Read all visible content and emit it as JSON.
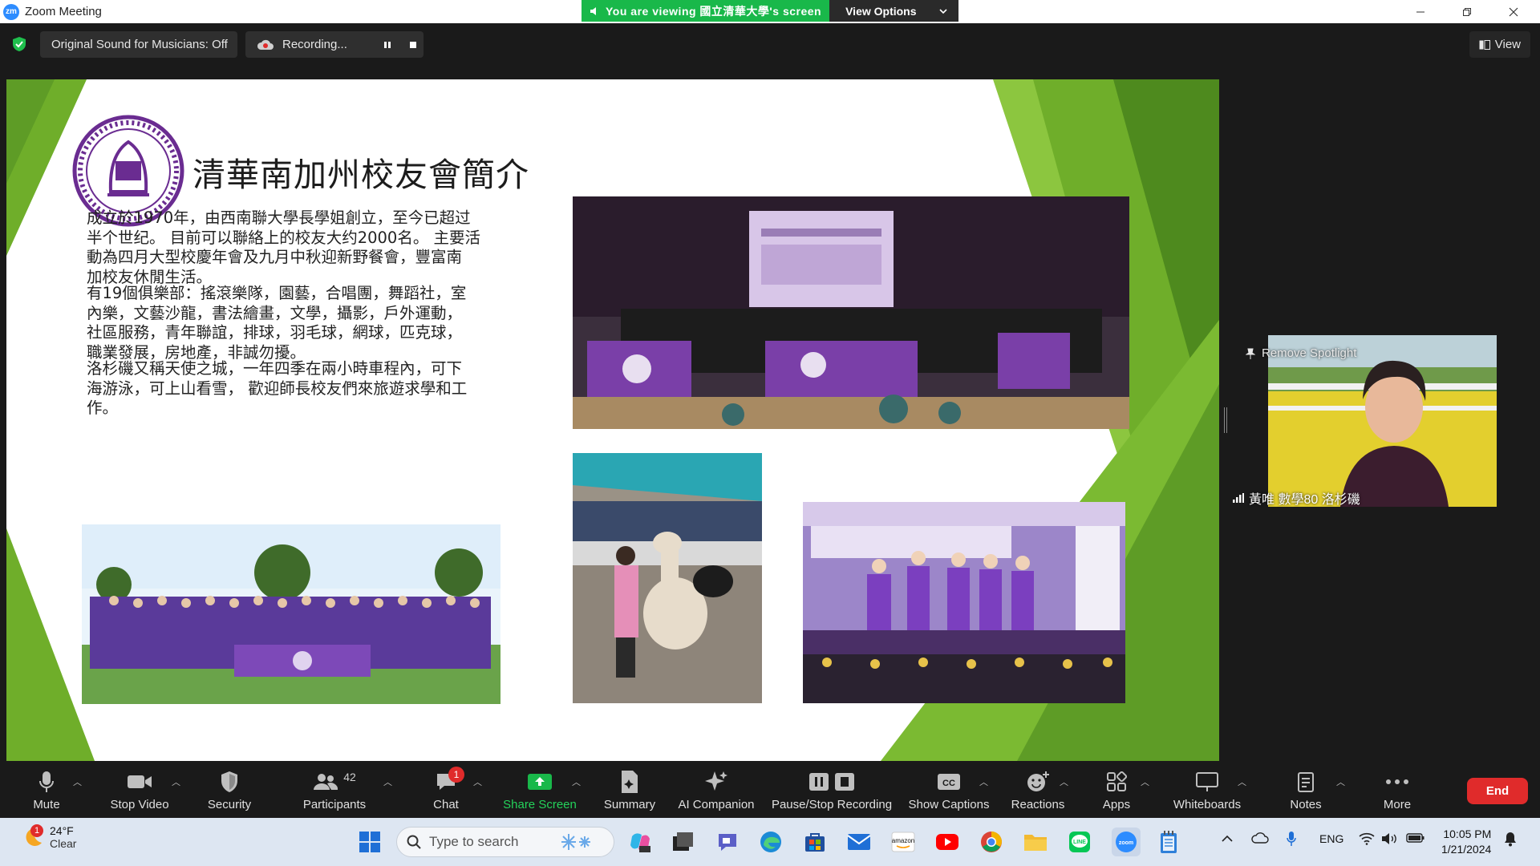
{
  "window": {
    "app_logo": "zm",
    "title": "Zoom Meeting"
  },
  "banner": {
    "viewing_text": "You are viewing 國立清華大學's screen",
    "view_options": "View Options"
  },
  "topbar": {
    "original_sound": "Original Sound for Musicians: Off",
    "recording": "Recording...",
    "view": "View"
  },
  "slide": {
    "title": "清華南加州校友會簡介",
    "paragraphs": [
      [
        "成立於1970年，由西南聯大學長學姐創立，至今已超过",
        "半个世纪。 目前可以聯絡上的校友大约2000名。 主要活",
        "動為四月大型校慶年會及九月中秋迎新野餐會，豐富南",
        "加校友休閒生活。"
      ],
      [
        "有19個俱樂部：搖滾樂隊，園藝，合唱團，舞蹈社，室",
        "內樂，文藝沙龍，書法繪畫，文學，攝影，戶外運動，",
        "社區服務，青年聯誼，排球，羽毛球，網球，匹克球，",
        "職業發展，房地產，非誠勿擾。"
      ],
      [
        "洛杉磯又稱天使之城，一年四季在兩小時車程內，可下",
        "海游泳，可上山看雪， 歡迎師長校友們來旅遊求學和工",
        "作。"
      ]
    ]
  },
  "participant": {
    "remove_spotlight": "Remove Spotlight",
    "name": "黃唯 數學80 洛杉磯"
  },
  "toolbar": {
    "mute": "Mute",
    "stop_video": "Stop Video",
    "security": "Security",
    "participants": "Participants",
    "participants_count": "42",
    "chat": "Chat",
    "chat_badge": "1",
    "share_screen": "Share Screen",
    "summary": "Summary",
    "ai_companion": "AI Companion",
    "pause_recording": "Pause/Stop Recording",
    "show_captions": "Show Captions",
    "reactions": "Reactions",
    "apps": "Apps",
    "whiteboards": "Whiteboards",
    "notes": "Notes",
    "more": "More",
    "end": "End"
  },
  "taskbar": {
    "weather_temp": "24°F",
    "weather_desc": "Clear",
    "weather_badge": "1",
    "search_placeholder": "Type to search",
    "lang": "ENG",
    "time": "10:05 PM",
    "date": "1/21/2024"
  },
  "colors": {
    "zoom_blue": "#2d8cff",
    "share_green": "#19b84a",
    "end_red": "#e02b2b",
    "slide_green": "#6fae2a",
    "purple": "#6a2c91"
  }
}
